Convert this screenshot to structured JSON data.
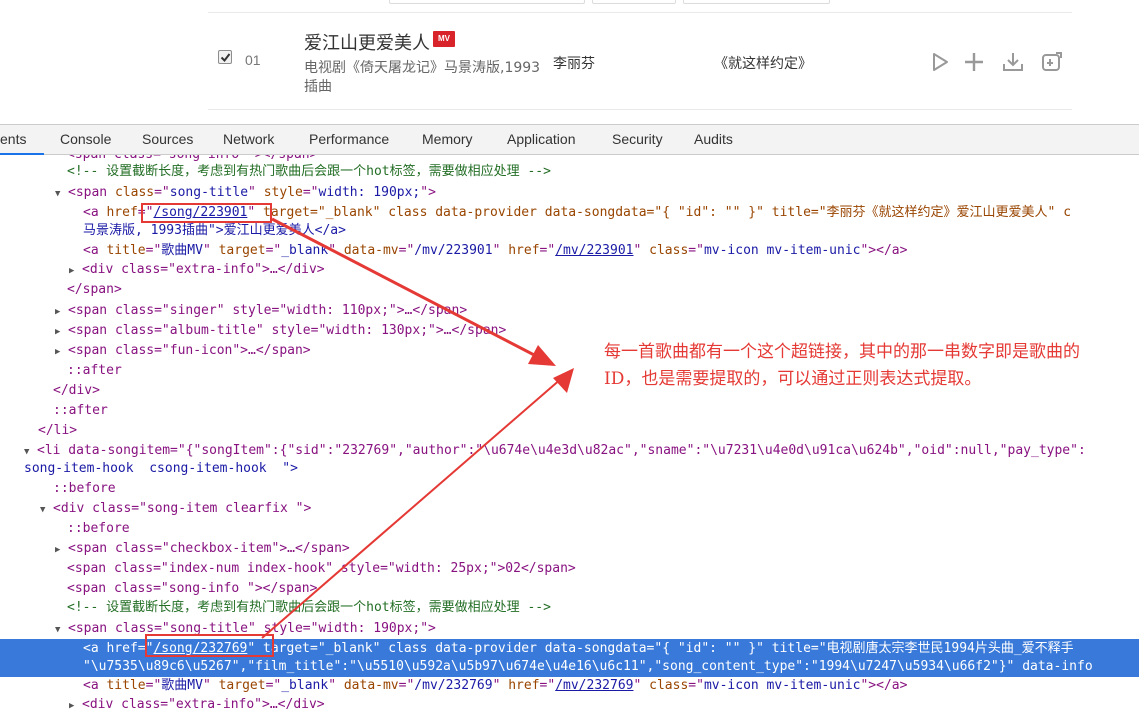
{
  "song": {
    "index": "01",
    "title": "爱江山更爱美人",
    "mv_badge": "MV",
    "description": "电视剧《倚天屠龙记》马景涛版,1993插曲",
    "singer": "李丽芬",
    "album": "《就这样约定》",
    "actions": [
      "play-icon",
      "add-icon",
      "download-icon",
      "share-icon"
    ]
  },
  "devtools": {
    "tabs": [
      "ents",
      "Console",
      "Sources",
      "Network",
      "Performance",
      "Memory",
      "Application",
      "Security",
      "Audits"
    ],
    "active_tab": "ents"
  },
  "code_lines": {
    "l0": "<span class=\"song-info \"></span>",
    "l1": "<!-- 设置截断长度，考虑到有热门歌曲后会跟一个hot标签，需要做相应处理 -->",
    "l2_tag": "span",
    "l2_attr1": "class",
    "l2_val1": "song-title",
    "l2_attr2": "style",
    "l2_val2": "width: 190px;",
    "l3_href": "/song/223901",
    "l3_rest": " target=\"_blank\" class data-provider data-songdata=\"{ \"id\": \"\" }\" title=\"李丽芬《就这样约定》爱江山更爱美人\" c",
    "l4": "马景涛版, 1993插曲\">爱江山更爱美人</a>",
    "l5_title": "歌曲MV",
    "l5_mv": "/mv/223901",
    "l5_href": "/mv/223901",
    "l5_class": "mv-icon mv-item-unic",
    "l6": "<div class=\"extra-info\">…</div>",
    "l7": "</span>",
    "l8": "<span class=\"singer\" style=\"width: 110px;\">…</span>",
    "l9": "<span class=\"album-title\" style=\"width: 130px;\">…</span>",
    "l10": "<span class=\"fun-icon\">…</span>",
    "l11": "::after",
    "l12": "</div>",
    "l13": "::after",
    "l14": "</li>",
    "l15": "<li data-songitem=\"{\"songItem\":{\"sid\":\"232769\",\"author\":\"\\u674e\\u4e3d\\u82ac\",\"sname\":\"\\u7231\\u4e0d\\u91ca\\u624b\",\"oid\":null,\"pay_type\":",
    "l16": "song-item-hook  csong-item-hook  \">",
    "l17": "::before",
    "l18": "<div class=\"song-item clearfix \">",
    "l19": "::before",
    "l20": "<span class=\"checkbox-item\">…</span>",
    "l21": "<span class=\"index-num index-hook\" style=\"width: 25px;\">02</span>",
    "l22": "<span class=\"song-info \"></span>",
    "l23": "<!-- 设置截断长度，考虑到有热门歌曲后会跟一个hot标签，需要做相应处理 -->",
    "l24": "<span class=\"song-title\" style=\"width: 190px;\">",
    "l25_href": "/song/232769",
    "l25_rest": " target=\"_blank\" class data-provider data-songdata=\"{ \"id\": \"\" }\" title=\"电视剧唐太宗李世民1994片头曲_爱不释手",
    "l26": "\"\\u7535\\u89c6\\u5267\",\"film_title\":\"\\u5510\\u592a\\u5b97\\u674e\\u4e16\\u6c11\",\"song_content_type\":\"1994\\u7247\\u5934\\u66f2\"}\" data-info",
    "l27_title": "歌曲MV",
    "l27_mv": "/mv/232769",
    "l27_href": "/mv/232769",
    "l27_class": "mv-icon mv-item-unic",
    "l28": "<div class=\"extra-info\">…</div>"
  },
  "annotation": "每一首歌曲都有一个这个超链接，其中的那一串数字即是歌曲的ID，也是需要提取的，可以通过正则表达式提取。",
  "colors": {
    "annotation": "#e53935",
    "selection": "#3879d9",
    "tab_active": "#1a73e8"
  }
}
